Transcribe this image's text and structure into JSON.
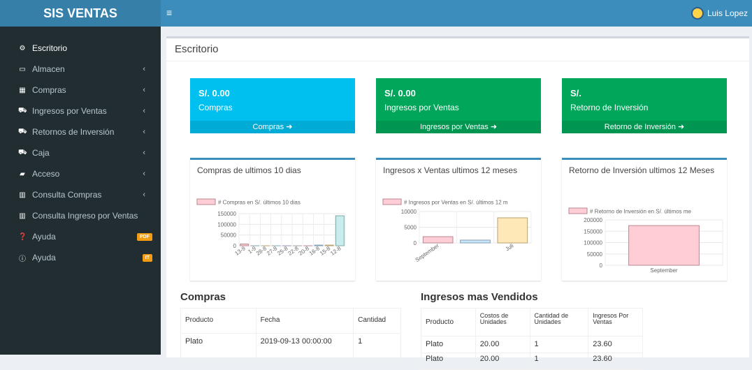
{
  "header": {
    "brand": "SIS VENTAS",
    "menu_icon": "≡",
    "user_name": "Luis Lopez"
  },
  "sidebar": {
    "items": [
      {
        "label": "Escritorio",
        "icon": "⚙",
        "icon_name": "dashboard-icon",
        "chevron": "",
        "badge": ""
      },
      {
        "label": "Almacen",
        "icon": "▭",
        "icon_name": "laptop-icon",
        "chevron": "‹",
        "badge": ""
      },
      {
        "label": "Compras",
        "icon": "▦",
        "icon_name": "th-icon",
        "chevron": "‹",
        "badge": ""
      },
      {
        "label": "Ingresos por Ventas",
        "icon": "⛟",
        "icon_name": "cart-icon",
        "chevron": "‹",
        "badge": ""
      },
      {
        "label": "Retornos de Inversión",
        "icon": "⛟",
        "icon_name": "cart-icon",
        "chevron": "‹",
        "badge": ""
      },
      {
        "label": "Caja",
        "icon": "⛟",
        "icon_name": "cart-icon",
        "chevron": "‹",
        "badge": ""
      },
      {
        "label": "Acceso",
        "icon": "▰",
        "icon_name": "folder-icon",
        "chevron": "‹",
        "badge": ""
      },
      {
        "label": "Consulta Compras",
        "icon": "▥",
        "icon_name": "bar-chart-icon",
        "chevron": "‹",
        "badge": ""
      },
      {
        "label": "Consulta Ingreso por Ventas",
        "icon": "▥",
        "icon_name": "bar-chart-icon",
        "chevron": "",
        "badge": ""
      },
      {
        "label": "Ayuda",
        "icon": "❓",
        "icon_name": "question-circle-icon",
        "chevron": "",
        "badge": "PDF",
        "badge_color": "#f39c12"
      },
      {
        "label": "Ayuda",
        "icon": "ⓘ",
        "icon_name": "info-circle-icon",
        "chevron": "",
        "badge": "IT",
        "badge_color": "#f39c12"
      }
    ]
  },
  "main": {
    "title": "Escritorio",
    "tiles": [
      {
        "value": "S/. 0.00",
        "label": "Compras",
        "footer": "Compras ➜",
        "color": "#00c0ef"
      },
      {
        "value": "S/. 0.00",
        "label": "Ingresos por Ventas",
        "footer": "Ingresos por Ventas ➜",
        "color": "#00a65a"
      },
      {
        "value": "S/.",
        "label": "Retorno de Inversión",
        "footer": "Retorno de Inversión ➜",
        "color": "#00a65a"
      }
    ],
    "charts_titles": [
      "Compras de ultimos 10 dias",
      "Ingresos x Ventas ultimos 12 meses",
      "Retorno de Inversión ultimos 12 Meses"
    ],
    "compras_table": {
      "title": "Compras",
      "headers": [
        "Producto",
        "Fecha",
        "Cantidad"
      ],
      "rows": [
        [
          "Plato",
          "2019-09-13 00:00:00",
          "1"
        ]
      ]
    },
    "ingresos_table": {
      "title": "Ingresos mas Vendidos",
      "headers": [
        "Producto",
        "Costos de Unidades",
        "Cantidad de Unidades",
        "Ingresos Por Ventas"
      ],
      "rows": [
        [
          "Plato",
          "20.00",
          "1",
          "23.60"
        ],
        [
          "Plato",
          "20.00",
          "1",
          "23.60"
        ]
      ]
    }
  },
  "chart_data": [
    {
      "type": "bar",
      "title": "Compras de ultimos 10 dias",
      "legend": "# Compras en S/. últimos 10 dias",
      "categories": [
        "13-9",
        "1-9",
        "28-8",
        "27-8",
        "25-8",
        "22-8",
        "20-8",
        "16-8",
        "15-8",
        "12-8"
      ],
      "values": [
        8000,
        0,
        0,
        0,
        0,
        0,
        0,
        3000,
        3000,
        140000
      ],
      "colors": [
        "#ffcdd6",
        "#c9e5f9",
        "#ffe8b8",
        "#c9eded",
        "#e1d5ff",
        "#e8e9eb",
        "#ffcdd6",
        "#c9e5f9",
        "#ffe8b8",
        "#c9eded"
      ],
      "yticks": [
        0,
        50000,
        100000,
        150000
      ],
      "ylim": [
        0,
        150000
      ]
    },
    {
      "type": "bar",
      "title": "Ingresos x Ventas ultimos 12 meses",
      "legend": "# Ingresos por Ventas en S/. últimos 12 m",
      "categories": [
        "September",
        "",
        "Juli"
      ],
      "values": [
        2000,
        900,
        8000
      ],
      "colors": [
        "#ffcdd6",
        "#c9e5f9",
        "#ffe8b8"
      ],
      "yticks": [
        0,
        5000,
        10000
      ],
      "ylim": [
        0,
        10000
      ]
    },
    {
      "type": "bar",
      "title": "Retorno de Inversión ultimos 12 Meses",
      "legend": "# Retorno de Inversión en S/. últimos me",
      "categories": [
        "September"
      ],
      "values": [
        175000
      ],
      "colors": [
        "#ffcdd6"
      ],
      "yticks": [
        0,
        50000,
        100000,
        150000,
        200000
      ],
      "ylim": [
        0,
        200000
      ]
    }
  ]
}
